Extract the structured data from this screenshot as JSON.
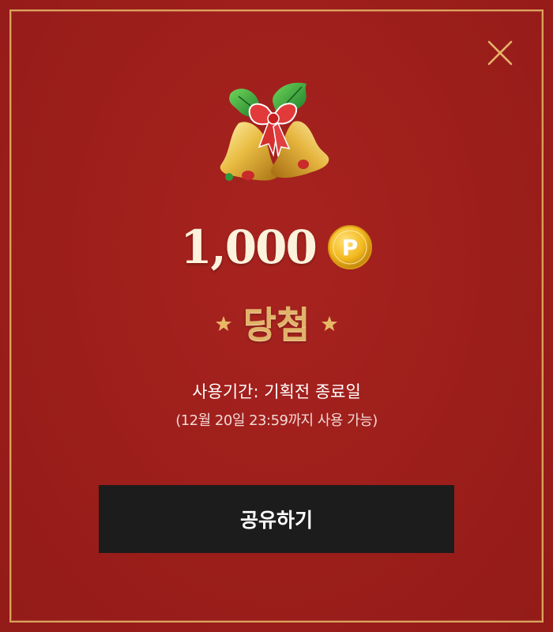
{
  "reward": {
    "amount": "1,000",
    "point_symbol": "P",
    "result": "당첨"
  },
  "info": {
    "period": "사용기간: 기획전 종료일",
    "period_detail": "(12월 20일 23:59까지 사용 가능)"
  },
  "actions": {
    "share_label": "공유하기",
    "close_icon": "close-icon"
  },
  "colors": {
    "background": "#9e1f1c",
    "frame": "#d9a35a",
    "gold_text": "#e1b26b",
    "button": "#1d1c1c"
  }
}
